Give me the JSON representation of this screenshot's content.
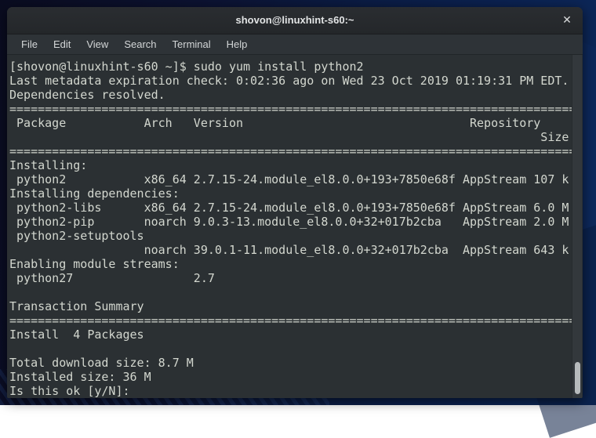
{
  "window": {
    "title": "shovon@linuxhint-s60:~",
    "close_icon": "✕"
  },
  "menu": {
    "items": [
      "File",
      "Edit",
      "View",
      "Search",
      "Terminal",
      "Help"
    ]
  },
  "terminal": {
    "lines": [
      "[shovon@linuxhint-s60 ~]$ sudo yum install python2",
      "Last metadata expiration check: 0:02:36 ago on Wed 23 Oct 2019 01:19:31 PM EDT.",
      "Dependencies resolved.",
      "================================================================================",
      " Package           Arch   Version                                Repository",
      "                                                                           Size",
      "================================================================================",
      "Installing:",
      " python2           x86_64 2.7.15-24.module_el8.0.0+193+7850e68f AppStream 107 k",
      "Installing dependencies:",
      " python2-libs      x86_64 2.7.15-24.module_el8.0.0+193+7850e68f AppStream 6.0 M",
      " python2-pip       noarch 9.0.3-13.module_el8.0.0+32+017b2cba   AppStream 2.0 M",
      " python2-setuptools",
      "                   noarch 39.0.1-11.module_el8.0.0+32+017b2cba  AppStream 643 k",
      "Enabling module streams:",
      " python27                 2.7",
      "",
      "Transaction Summary",
      "================================================================================",
      "Install  4 Packages",
      "",
      "Total download size: 8.7 M",
      "Installed size: 36 M",
      "Is this ok [y/N]: "
    ]
  },
  "colors": {
    "titlebar": "#2a2d31",
    "menubar": "#2e3337",
    "terminal_bg": "#2b3033",
    "terminal_fg": "#d3d7cf",
    "scrollbar_thumb": "#b6babc",
    "desktop": "#0b1c44"
  }
}
